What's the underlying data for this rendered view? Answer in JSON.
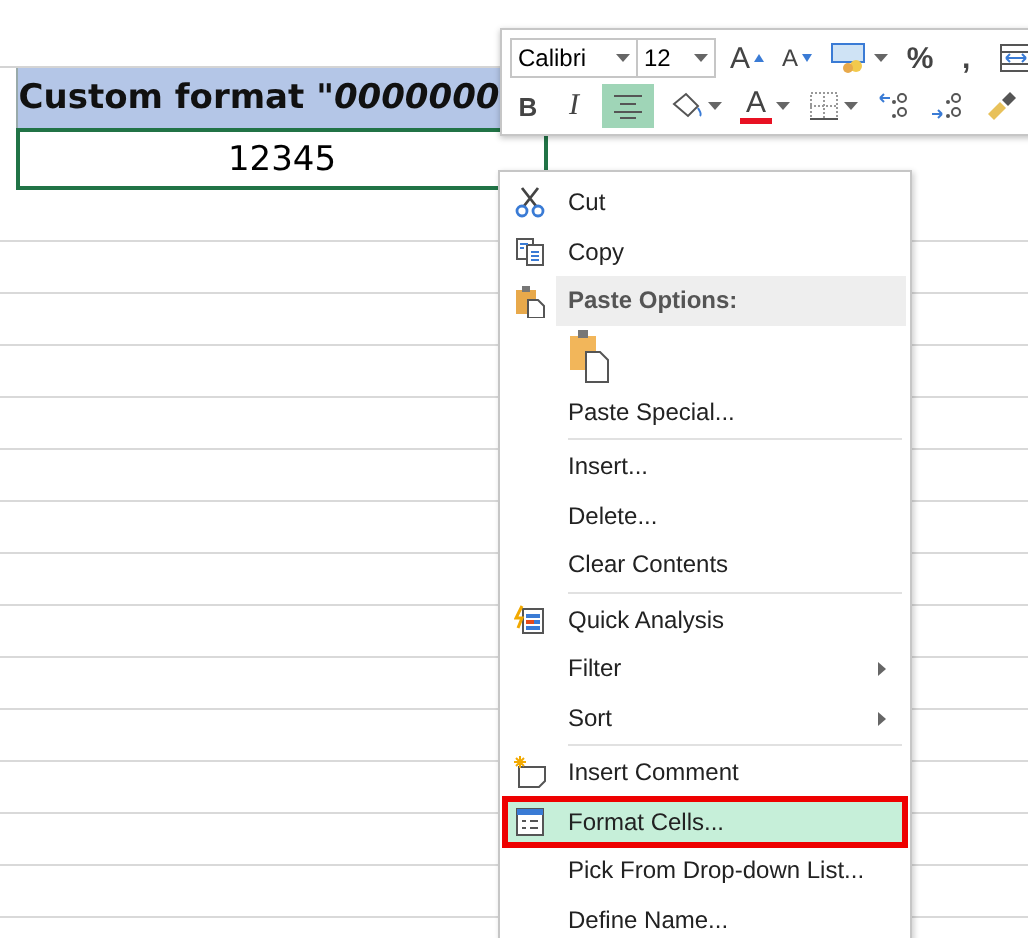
{
  "sheet": {
    "header_cell": "Custom format \"*0000000*",
    "value_cell": "12345"
  },
  "mini_toolbar": {
    "font": "Calibri",
    "size": "12",
    "row1": [
      {
        "kind": "grow",
        "label": "A"
      },
      {
        "kind": "shrink",
        "label": "A"
      },
      {
        "kind": "number-format"
      },
      {
        "kind": "text",
        "label": "%"
      },
      {
        "kind": "text",
        "label": ","
      },
      {
        "kind": "wrap"
      }
    ],
    "row2": [
      {
        "kind": "bold",
        "label": "B",
        "on": false
      },
      {
        "kind": "italic",
        "label": "I",
        "on": false
      },
      {
        "kind": "align",
        "on": true
      },
      {
        "kind": "fill"
      },
      {
        "kind": "font-color",
        "label": "A",
        "color": "#e81123"
      },
      {
        "kind": "borders"
      },
      {
        "kind": "inc-decimal"
      },
      {
        "kind": "dec-decimal"
      },
      {
        "kind": "painter"
      }
    ]
  },
  "context_menu": [
    {
      "kind": "cut",
      "label": "Cut",
      "selected": false
    },
    {
      "kind": "copy",
      "label": "Copy",
      "selected": false
    },
    {
      "kind": "header",
      "label": "Paste Options:",
      "selected": false
    },
    {
      "kind": "paste-button",
      "selected": false
    },
    {
      "kind": "plain",
      "label": "Paste Special...",
      "selected": false
    },
    {
      "kind": "separator"
    },
    {
      "kind": "plain",
      "label": "Insert...",
      "selected": false
    },
    {
      "kind": "plain",
      "label": "Delete...",
      "selected": false
    },
    {
      "kind": "plain",
      "label": "Clear Contents",
      "selected": false
    },
    {
      "kind": "separator"
    },
    {
      "kind": "quick",
      "label": "Quick Analysis",
      "selected": false
    },
    {
      "kind": "submenu",
      "label": "Filter",
      "selected": false
    },
    {
      "kind": "submenu",
      "label": "Sort",
      "selected": false
    },
    {
      "kind": "separator"
    },
    {
      "kind": "comment",
      "label": "Insert Comment",
      "selected": false
    },
    {
      "kind": "format",
      "label": "Format Cells...",
      "selected": true
    },
    {
      "kind": "plain",
      "label": "Pick From Drop-down List...",
      "selected": false
    },
    {
      "kind": "plain",
      "label": "Define Name...",
      "selected": false
    }
  ]
}
